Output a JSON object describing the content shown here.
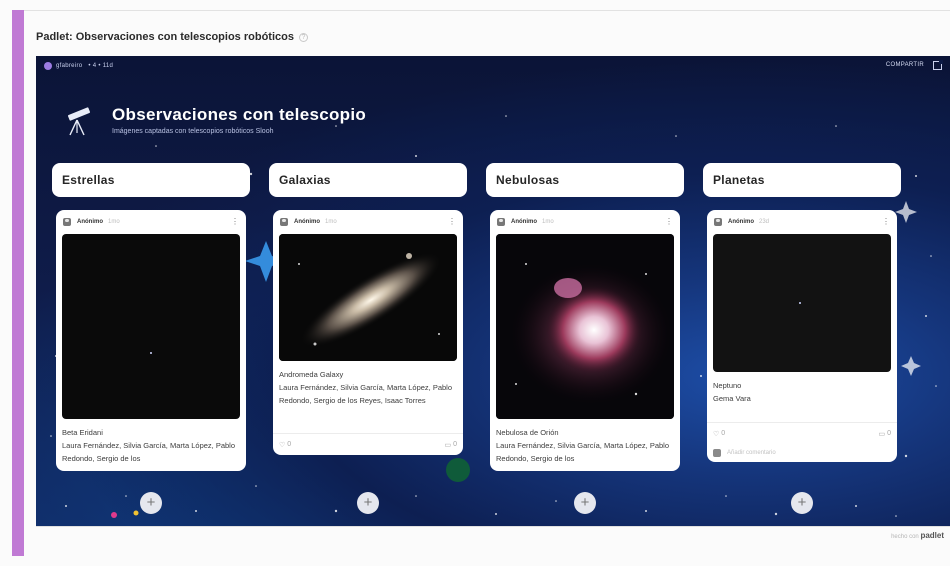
{
  "page": {
    "title": "Padlet: Observaciones con telescopios robóticos"
  },
  "topbar": {
    "user": "gfabreiro",
    "stats": "• 4  •  11d",
    "share_label": "COMPARTIR"
  },
  "board": {
    "title": "Observaciones con telescopio",
    "subtitle": "Imágenes captadas con telescopios robóticos Slooh"
  },
  "columns": [
    {
      "title": "Estrellas",
      "card": {
        "author": "Anónimo",
        "time": "1mo",
        "caption": "Beta Eridani",
        "authors": "Laura Fernández, Silvia García, Marta López, Pablo Redondo, Sergio de los"
      }
    },
    {
      "title": "Galaxias",
      "card": {
        "author": "Anónimo",
        "time": "1mo",
        "caption": "Andromeda Galaxy",
        "authors": "Laura Fernández, Silvia García, Marta López, Pablo Redondo, Sergio de los Reyes, Isaac Torres",
        "likes": "0",
        "comments": "0"
      }
    },
    {
      "title": "Nebulosas",
      "card": {
        "author": "Anónimo",
        "time": "1mo",
        "caption": "Nebulosa de Orión",
        "authors": "Laura Fernández, Silvia García, Marta López, Pablo Redondo, Sergio de los"
      }
    },
    {
      "title": "Planetas",
      "card": {
        "author": "Anónimo",
        "time": "23d",
        "caption": "Neptuno",
        "authors": "Gema Vara",
        "likes": "0",
        "comments": "0",
        "add_comment": "Añadir comentario"
      }
    }
  ],
  "footer": {
    "made_with": "hecho con",
    "brand": "padlet"
  },
  "colors": {
    "accent_bar": "#c07ad4",
    "board_bg": "#0f1c4a"
  }
}
